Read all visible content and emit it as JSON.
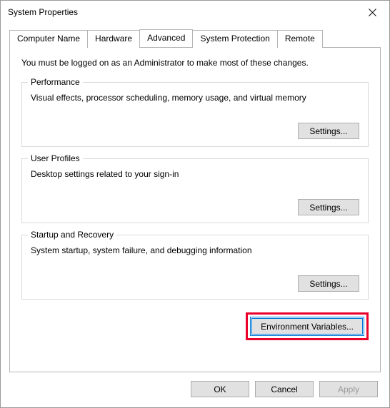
{
  "window": {
    "title": "System Properties"
  },
  "tabs": {
    "computer_name": "Computer Name",
    "hardware": "Hardware",
    "advanced": "Advanced",
    "system_protection": "System Protection",
    "remote": "Remote"
  },
  "advanced": {
    "admin_note": "You must be logged on as an Administrator to make most of these changes.",
    "performance": {
      "title": "Performance",
      "desc": "Visual effects, processor scheduling, memory usage, and virtual memory",
      "settings_label": "Settings..."
    },
    "user_profiles": {
      "title": "User Profiles",
      "desc": "Desktop settings related to your sign-in",
      "settings_label": "Settings..."
    },
    "startup_recovery": {
      "title": "Startup and Recovery",
      "desc": "System startup, system failure, and debugging information",
      "settings_label": "Settings..."
    },
    "env_vars_label": "Environment Variables..."
  },
  "buttons": {
    "ok": "OK",
    "cancel": "Cancel",
    "apply": "Apply"
  }
}
